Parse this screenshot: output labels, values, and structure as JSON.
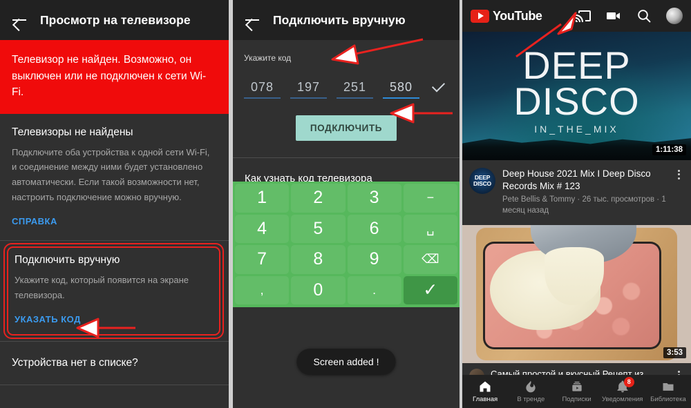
{
  "panel_tv": {
    "appbar": {
      "title": "Просмотр на телевизоре",
      "back_icon": "back-arrow-icon"
    },
    "banner": "Телевизор не найден. Возможно, он выключен или не подключен к сети Wi-Fi.",
    "banner_color": "#f00b0b",
    "not_found_card": {
      "title": "Телевизоры не найдены",
      "body": "Подключите оба устройства к одной сети Wi-Fi, и соединение между ними будет установлено автоматически. Если такой возможности нет, настроить подключение можно вручную.",
      "link": "СПРАВКА"
    },
    "manual_card": {
      "title": "Подключить вручную",
      "body": "Укажите код, который появится на экране телевизора.",
      "link": "УКАЗАТЬ КОД"
    },
    "missing_row": "Устройства нет в списке?",
    "highlight_color": "#e8221f"
  },
  "panel_manual": {
    "appbar": {
      "title": "Подключить вручную",
      "back_icon": "back-arrow-icon"
    },
    "code_label": "Укажите код",
    "code_fields": [
      "078",
      "197",
      "251",
      "580"
    ],
    "code_confirm_icon": "check-icon",
    "connect_button": "ПОДКЛЮЧИТЬ",
    "connect_button_color": "#9fd8cd",
    "hint_row": "Как узнать код телевизора",
    "toast": "Screen added !",
    "keypad": {
      "color": "#63bd68",
      "enter_color": "#3f9646",
      "keys": [
        {
          "label": "1",
          "name": "key-1",
          "type": "digit"
        },
        {
          "label": "2",
          "name": "key-2",
          "type": "digit"
        },
        {
          "label": "3",
          "name": "key-3",
          "type": "digit"
        },
        {
          "label": "−",
          "name": "key-minus",
          "type": "symbol"
        },
        {
          "label": "4",
          "name": "key-4",
          "type": "digit"
        },
        {
          "label": "5",
          "name": "key-5",
          "type": "digit"
        },
        {
          "label": "6",
          "name": "key-6",
          "type": "digit"
        },
        {
          "label": "␣",
          "name": "key-space",
          "type": "symbol"
        },
        {
          "label": "7",
          "name": "key-7",
          "type": "digit"
        },
        {
          "label": "8",
          "name": "key-8",
          "type": "digit"
        },
        {
          "label": "9",
          "name": "key-9",
          "type": "digit"
        },
        {
          "label": "⌫",
          "name": "key-backspace",
          "type": "symbol"
        },
        {
          "label": ",",
          "name": "key-comma",
          "type": "symbol"
        },
        {
          "label": "0",
          "name": "key-0",
          "type": "digit"
        },
        {
          "label": ".",
          "name": "key-period",
          "type": "symbol"
        },
        {
          "label": "✓",
          "name": "key-enter",
          "type": "enter"
        }
      ]
    }
  },
  "panel_youtube": {
    "brand": "YouTube",
    "bar_icons": [
      "cast-icon",
      "camera-icon",
      "search-icon",
      "avatar"
    ],
    "video1": {
      "art_line1": "DEEP",
      "art_line2": "DISCO",
      "art_line3": "IN_THE_MIX",
      "duration": "1:11:38",
      "channel_badge_l1": "DEEP",
      "channel_badge_l2": "DISCO",
      "title": "Deep House 2021 Mix I Deep Disco Records Mix # 123",
      "subtitle": "Pete Bellis & Tommy · 26 тыс. просмотров · 1 месяц назад"
    },
    "video2": {
      "duration": "3:53",
      "title": "Самый простой и вкусный Рецепт из"
    },
    "nav": [
      {
        "label": "Главная",
        "icon": "home-icon",
        "active": true,
        "badge": ""
      },
      {
        "label": "В тренде",
        "icon": "flame-icon",
        "active": false,
        "badge": ""
      },
      {
        "label": "Подписки",
        "icon": "subscriptions-icon",
        "active": false,
        "badge": ""
      },
      {
        "label": "Уведомления",
        "icon": "bell-icon",
        "active": false,
        "badge": "8"
      },
      {
        "label": "Библиотека",
        "icon": "library-icon",
        "active": false,
        "badge": ""
      }
    ]
  }
}
